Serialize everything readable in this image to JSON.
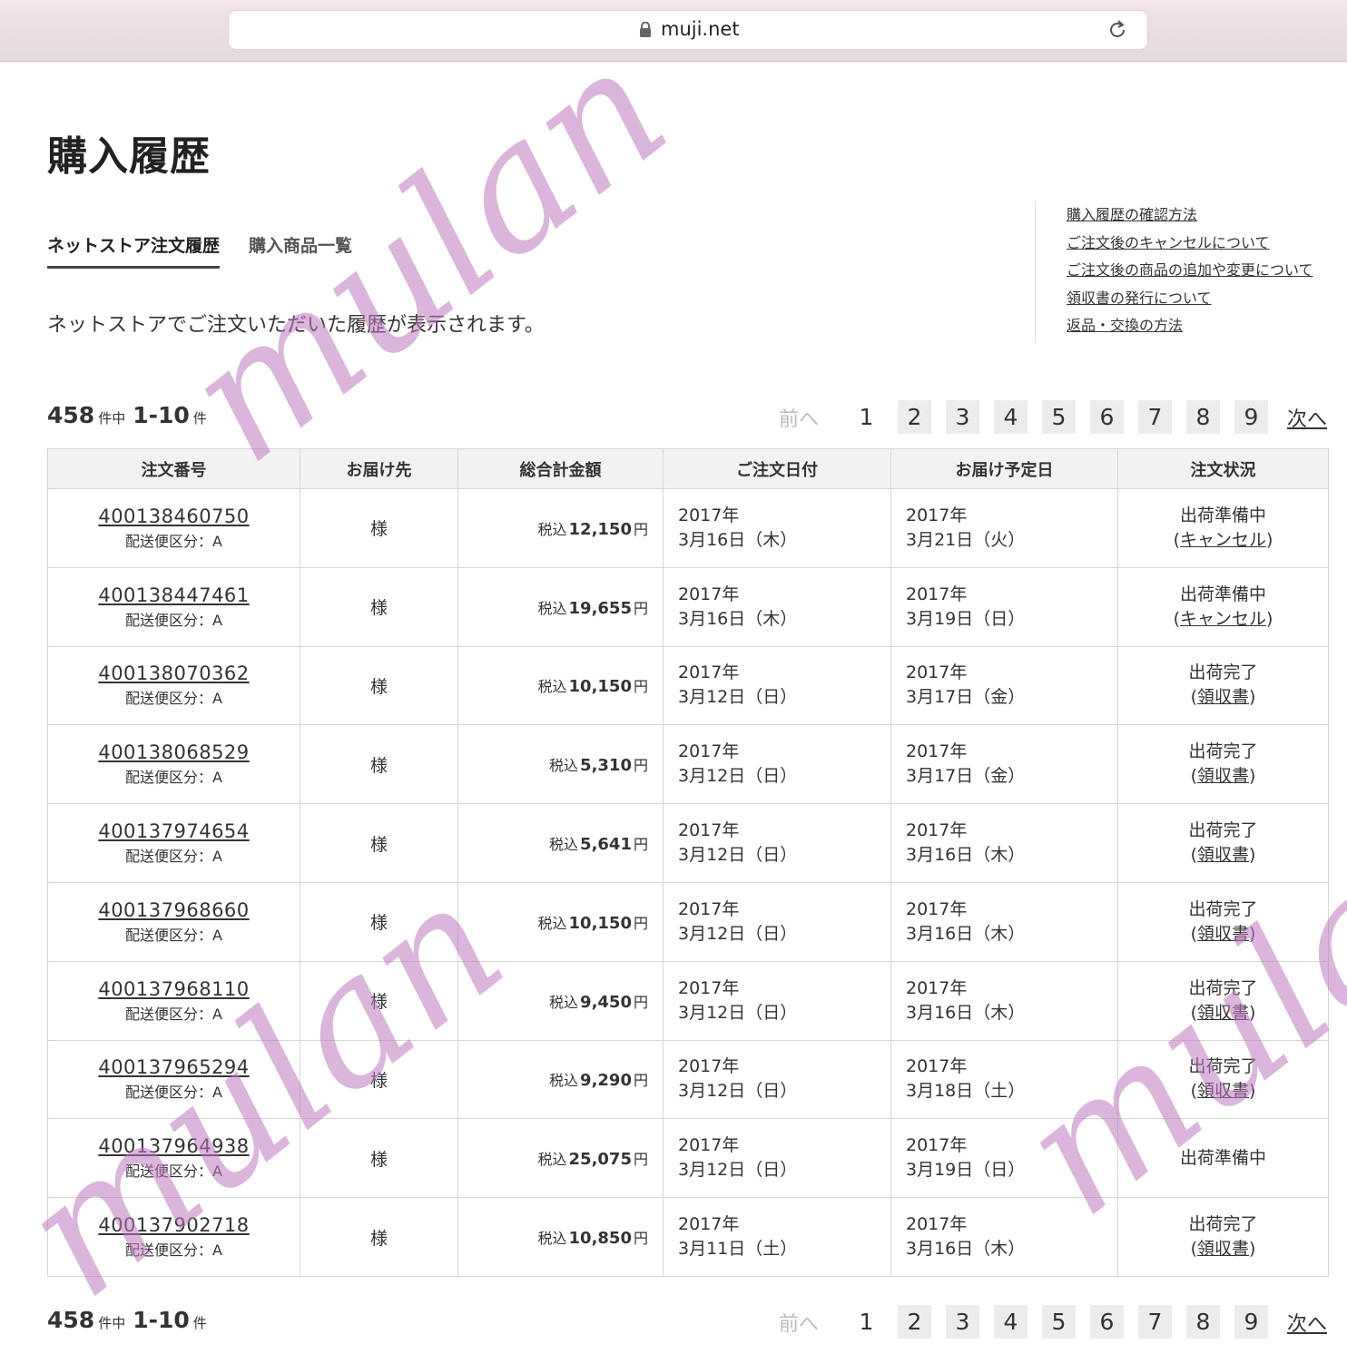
{
  "browser": {
    "url": "muji.net"
  },
  "page": {
    "title": "購入履歴",
    "tabs": [
      {
        "label": "ネットストア注文履歴"
      },
      {
        "label": "購入商品一覧"
      }
    ],
    "intro": "ネットストアでご注文いただいた履歴が表示されます。",
    "help_links": [
      "購入履歴の確認方法",
      "ご注文後のキャンセルについて",
      "ご注文後の商品の追加や変更について",
      "領収書の発行について",
      "返品・交換の方法"
    ]
  },
  "pagination": {
    "total": "458",
    "total_unit": "件中",
    "range": "1-10",
    "range_unit": "件",
    "prev": "前へ",
    "next": "次へ",
    "pages": [
      "1",
      "2",
      "3",
      "4",
      "5",
      "6",
      "7",
      "8",
      "9"
    ],
    "current": "1"
  },
  "table": {
    "headers": [
      "注文番号",
      "お届け先",
      "総合計金額",
      "ご注文日付",
      "お届け予定日",
      "注文状況"
    ],
    "tax_label": "税込",
    "currency": "円",
    "rows": [
      {
        "order_no": "400138460750",
        "category": "配送便区分：A",
        "dest": "様",
        "amount": "12,150",
        "order_year": "2017年",
        "order_day": "3月16日（木）",
        "delivery_year": "2017年",
        "delivery_day": "3月21日（火）",
        "status": "出荷準備中",
        "status_link": "キャンセル"
      },
      {
        "order_no": "400138447461",
        "category": "配送便区分：A",
        "dest": "様",
        "amount": "19,655",
        "order_year": "2017年",
        "order_day": "3月16日（木）",
        "delivery_year": "2017年",
        "delivery_day": "3月19日（日）",
        "status": "出荷準備中",
        "status_link": "キャンセル"
      },
      {
        "order_no": "400138070362",
        "category": "配送便区分：A",
        "dest": "様",
        "amount": "10,150",
        "order_year": "2017年",
        "order_day": "3月12日（日）",
        "delivery_year": "2017年",
        "delivery_day": "3月17日（金）",
        "status": "出荷完了",
        "status_link": "領収書"
      },
      {
        "order_no": "400138068529",
        "category": "配送便区分：A",
        "dest": "様",
        "amount": "5,310",
        "order_year": "2017年",
        "order_day": "3月12日（日）",
        "delivery_year": "2017年",
        "delivery_day": "3月17日（金）",
        "status": "出荷完了",
        "status_link": "領収書"
      },
      {
        "order_no": "400137974654",
        "category": "配送便区分：A",
        "dest": "様",
        "amount": "5,641",
        "order_year": "2017年",
        "order_day": "3月12日（日）",
        "delivery_year": "2017年",
        "delivery_day": "3月16日（木）",
        "status": "出荷完了",
        "status_link": "領収書"
      },
      {
        "order_no": "400137968660",
        "category": "配送便区分：A",
        "dest": "様",
        "amount": "10,150",
        "order_year": "2017年",
        "order_day": "3月12日（日）",
        "delivery_year": "2017年",
        "delivery_day": "3月16日（木）",
        "status": "出荷完了",
        "status_link": "領収書"
      },
      {
        "order_no": "400137968110",
        "category": "配送便区分：A",
        "dest": "様",
        "amount": "9,450",
        "order_year": "2017年",
        "order_day": "3月12日（日）",
        "delivery_year": "2017年",
        "delivery_day": "3月16日（木）",
        "status": "出荷完了",
        "status_link": "領収書"
      },
      {
        "order_no": "400137965294",
        "category": "配送便区分：A",
        "dest": "様",
        "amount": "9,290",
        "order_year": "2017年",
        "order_day": "3月12日（日）",
        "delivery_year": "2017年",
        "delivery_day": "3月18日（土）",
        "status": "出荷完了",
        "status_link": "領収書"
      },
      {
        "order_no": "400137964938",
        "category": "配送便区分：A",
        "dest": "様",
        "amount": "25,075",
        "order_year": "2017年",
        "order_day": "3月12日（日）",
        "delivery_year": "2017年",
        "delivery_day": "3月19日（日）",
        "status": "出荷準備中",
        "status_link": ""
      },
      {
        "order_no": "400137902718",
        "category": "配送便区分：A",
        "dest": "様",
        "amount": "10,850",
        "order_year": "2017年",
        "order_day": "3月11日（土）",
        "delivery_year": "2017年",
        "delivery_day": "3月16日（木）",
        "status": "出荷完了",
        "status_link": "領収書"
      }
    ]
  },
  "watermark": {
    "text": "mulan",
    "color": "#be78be"
  }
}
